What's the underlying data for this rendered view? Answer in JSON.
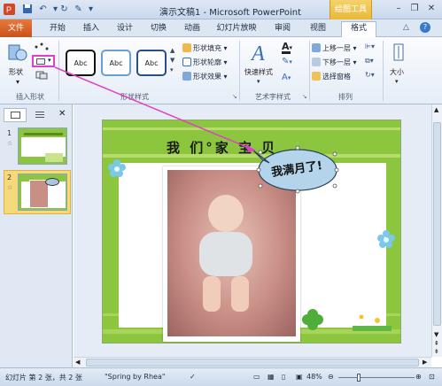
{
  "window": {
    "title": "演示文稿1 - Microsoft PowerPoint",
    "contextual_tab": "绘图工具"
  },
  "quick_access": [
    "save-icon",
    "undo-icon",
    "redo-icon",
    "customize-icon"
  ],
  "tabs": [
    {
      "label": "文件"
    },
    {
      "label": "开始"
    },
    {
      "label": "插入"
    },
    {
      "label": "设计"
    },
    {
      "label": "切换"
    },
    {
      "label": "动画"
    },
    {
      "label": "幻灯片放映"
    },
    {
      "label": "审阅"
    },
    {
      "label": "视图"
    },
    {
      "label": "格式"
    }
  ],
  "ribbon": {
    "insert_shape": {
      "shape_button": "形状",
      "group_label": "插入形状"
    },
    "shape_styles": {
      "style_items": [
        "Abc",
        "Abc",
        "Abc"
      ],
      "fill": "形状填充",
      "outline": "形状轮廓",
      "effects": "形状效果",
      "group_label": "形状样式"
    },
    "art_text": {
      "quick_styles": "快速样式",
      "group_label": "艺术字样式"
    },
    "arrange": {
      "bring_forward": "上移一层",
      "send_backward": "下移一层",
      "selection_pane": "选择窗格",
      "group_label": "排列"
    },
    "size": {
      "label": "大小"
    }
  },
  "slides_panel": {
    "items": [
      {
        "number": "1"
      },
      {
        "number": "2"
      }
    ]
  },
  "slide": {
    "title": "我 们°家 宝 贝",
    "callout_text": "我满月了!"
  },
  "status": {
    "slide_info": "幻灯片 第 2 张，共 2 张",
    "theme": "\"Spring by Rhea\"",
    "zoom": "48%"
  },
  "colors": {
    "accent": "#8cc63f",
    "file_tab": "#d2642a",
    "annotation": "#e040c8"
  }
}
